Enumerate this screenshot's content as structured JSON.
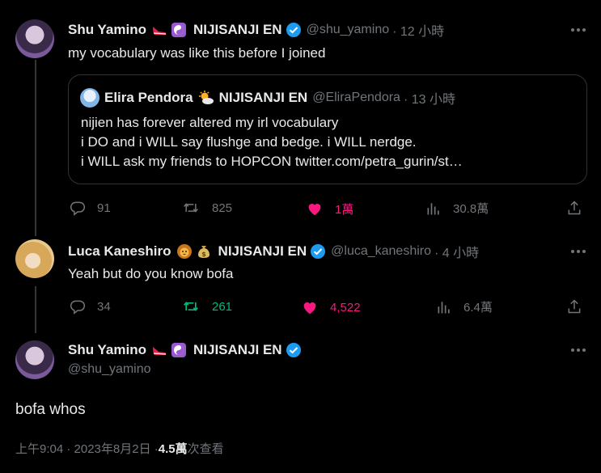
{
  "tweet1": {
    "name": "Shu Yamino",
    "affiliation": "NIJISANJI EN",
    "handle": "@shu_yamino",
    "time": "· 12 小時",
    "text": "my vocabulary was like this before I joined",
    "quote": {
      "name": "Elira Pendora",
      "affiliation": "NIJISANJI EN",
      "handle": "@EliraPendora",
      "time": "· 13 小時",
      "lines": [
        "nijien has forever altered my irl vocabulary",
        "i DO and i WILL say flushge and bedge. i WILL nerdge.",
        "i WILL ask my friends to HOPCON twitter.com/petra_gurin/st…"
      ]
    },
    "actions": {
      "replies": "91",
      "retweets": "825",
      "likes": "1萬",
      "views": "30.8萬"
    }
  },
  "tweet2": {
    "name": "Luca Kaneshiro",
    "affiliation": "NIJISANJI EN",
    "handle": "@luca_kaneshiro",
    "time": "· 4 小時",
    "text": "Yeah but do you know bofa",
    "actions": {
      "replies": "34",
      "retweets": "261",
      "likes": "4,522",
      "views": "6.4萬"
    }
  },
  "tweet3": {
    "name": "Shu Yamino",
    "affiliation": "NIJISANJI EN",
    "handle": "@shu_yamino",
    "text": "bofa whos",
    "timestamp": "上午9:04 · 2023年8月2日 · ",
    "views_count": "4.5萬",
    "views_label": " 次查看"
  },
  "colors": {
    "liked": "#f91880",
    "retweeted": "#00ba7c",
    "verified": "#1d9bf0",
    "muted": "#71767b"
  }
}
